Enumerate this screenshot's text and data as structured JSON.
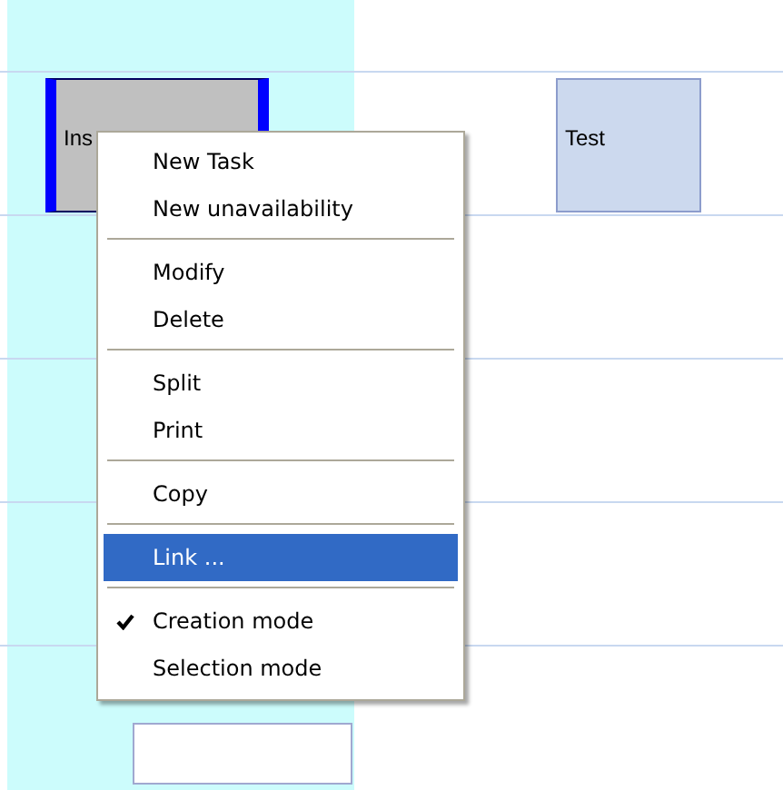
{
  "tasks": [
    {
      "label": "Ins",
      "kind": "selected-task"
    },
    {
      "label": "Test",
      "kind": "task"
    },
    {
      "kind": "empty-task"
    }
  ],
  "context_menu": [
    {
      "kind": "item",
      "label": "New Task",
      "checked": false,
      "selected": false
    },
    {
      "kind": "item",
      "label": "New unavailability",
      "checked": false,
      "selected": false
    },
    {
      "kind": "separator"
    },
    {
      "kind": "item",
      "label": "Modify",
      "checked": false,
      "selected": false
    },
    {
      "kind": "item",
      "label": "Delete",
      "checked": false,
      "selected": false
    },
    {
      "kind": "separator"
    },
    {
      "kind": "item",
      "label": "Split",
      "checked": false,
      "selected": false
    },
    {
      "kind": "item",
      "label": "Print",
      "checked": false,
      "selected": false
    },
    {
      "kind": "separator"
    },
    {
      "kind": "item",
      "label": "Copy",
      "checked": false,
      "selected": false
    },
    {
      "kind": "separator"
    },
    {
      "kind": "item",
      "label": "Link ...",
      "checked": false,
      "selected": true
    },
    {
      "kind": "separator"
    },
    {
      "kind": "item",
      "label": "Creation mode",
      "checked": true,
      "selected": false
    },
    {
      "kind": "item",
      "label": "Selection mode",
      "checked": false,
      "selected": false
    }
  ]
}
